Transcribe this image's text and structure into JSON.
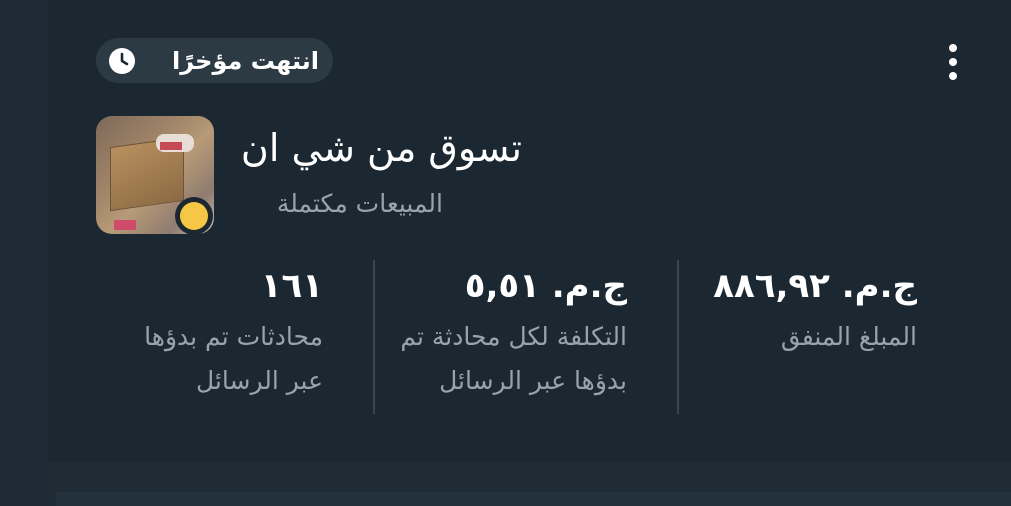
{
  "badge": {
    "label": "انتهت مؤخرًا",
    "icon": "clock-icon"
  },
  "menu": {
    "icon": "more-vertical-icon"
  },
  "campaign": {
    "title": "تسوق من شي ان",
    "subtitle": "المبيعات مكتملة",
    "status_color": "#f6c744",
    "thumbnail": "product-box-image"
  },
  "metrics": [
    {
      "value": "ج.م. ٨٨٦,٩٢",
      "label_lines": [
        "المبلغ المنفق"
      ]
    },
    {
      "value": "ج.م. ٥,٥١",
      "label_lines": [
        "التكلفة لكل محادثة تم",
        "بدؤها عبر الرسائل"
      ]
    },
    {
      "value": "١٦١",
      "label_lines": [
        "محادثات تم بدؤها",
        "عبر الرسائل"
      ]
    }
  ],
  "colors": {
    "card_background": "#1b2831",
    "badge_background": "#2c3a44",
    "primary_text": "#ffffff",
    "secondary_text": "#98a3ab",
    "status_dot": "#f6c744"
  }
}
